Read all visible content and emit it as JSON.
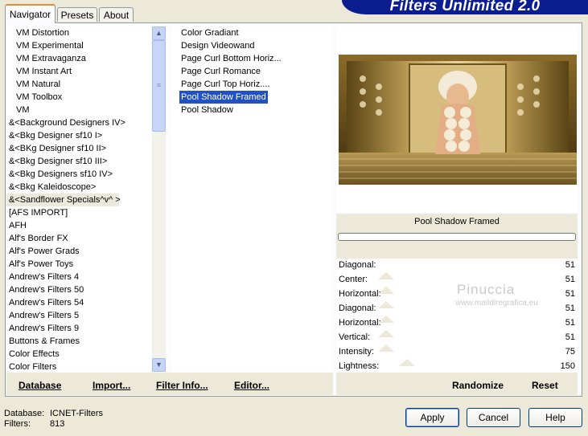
{
  "tabs": [
    "Navigator",
    "Presets",
    "About"
  ],
  "banner_title": "Filters Unlimited 2.0",
  "categories": [
    "VM Distortion",
    "VM Experimental",
    "VM Extravaganza",
    "VM Instant Art",
    "VM Natural",
    "VM Toolbox",
    "VM",
    "&<Background Designers IV>",
    "&<Bkg Designer sf10 I>",
    "&<BKg Designer sf10 II>",
    "&<Bkg Designer sf10 III>",
    "&<Bkg Designers sf10 IV>",
    "&<Bkg Kaleidoscope>",
    "&<Sandflower Specials^v^ >",
    "[AFS IMPORT]",
    "AFH",
    "Alf's Border FX",
    "Alf's Power Grads",
    "Alf's Power Toys",
    "Andrew's Filters 4",
    "Andrew's Filters 50",
    "Andrew's Filters 54",
    "Andrew's Filters 5",
    "Andrew's Filters 9",
    "Buttons & Frames",
    "Color Effects",
    "Color Filters"
  ],
  "highlighted_category": "&<Sandflower Specials^v^ >",
  "filters": [
    "Color Gradiant",
    "Design Videowand",
    "Page Curl Bottom Horiz...",
    "Page Curl Romance",
    "Page Curl Top Horiz....",
    "Pool Shadow Framed",
    "Pool Shadow"
  ],
  "selected_filter": "Pool Shadow Framed",
  "preview_filter_name": "Pool Shadow Framed",
  "progress": 0,
  "params": [
    {
      "label": "Diagonal:",
      "value": "51"
    },
    {
      "label": "Center:",
      "value": "51"
    },
    {
      "label": "Horizontal:",
      "value": "51"
    },
    {
      "label": "Diagonal:",
      "value": "51"
    },
    {
      "label": "Horizontal:",
      "value": "51"
    },
    {
      "label": "Vertical:",
      "value": "51"
    },
    {
      "label": "Intensity:",
      "value": "75"
    },
    {
      "label": "Lightness:",
      "value": "150"
    }
  ],
  "watermark": {
    "name": "Pinuccia",
    "url": "www.maildiregrafica.eu"
  },
  "buttons": {
    "database": "Database",
    "import": "Import...",
    "filter_info": "Filter Info...",
    "editor": "Editor...",
    "randomize": "Randomize",
    "reset": "Reset",
    "apply": "Apply",
    "cancel": "Cancel",
    "help": "Help"
  },
  "status": {
    "database_label": "Database:",
    "database_value": "ICNET-Filters",
    "filters_label": "Filters:",
    "filters_value": "813"
  },
  "colors": {
    "banner": "#0b1d8f",
    "selection": "#2151c3",
    "active_tab": "#e68b2c"
  }
}
